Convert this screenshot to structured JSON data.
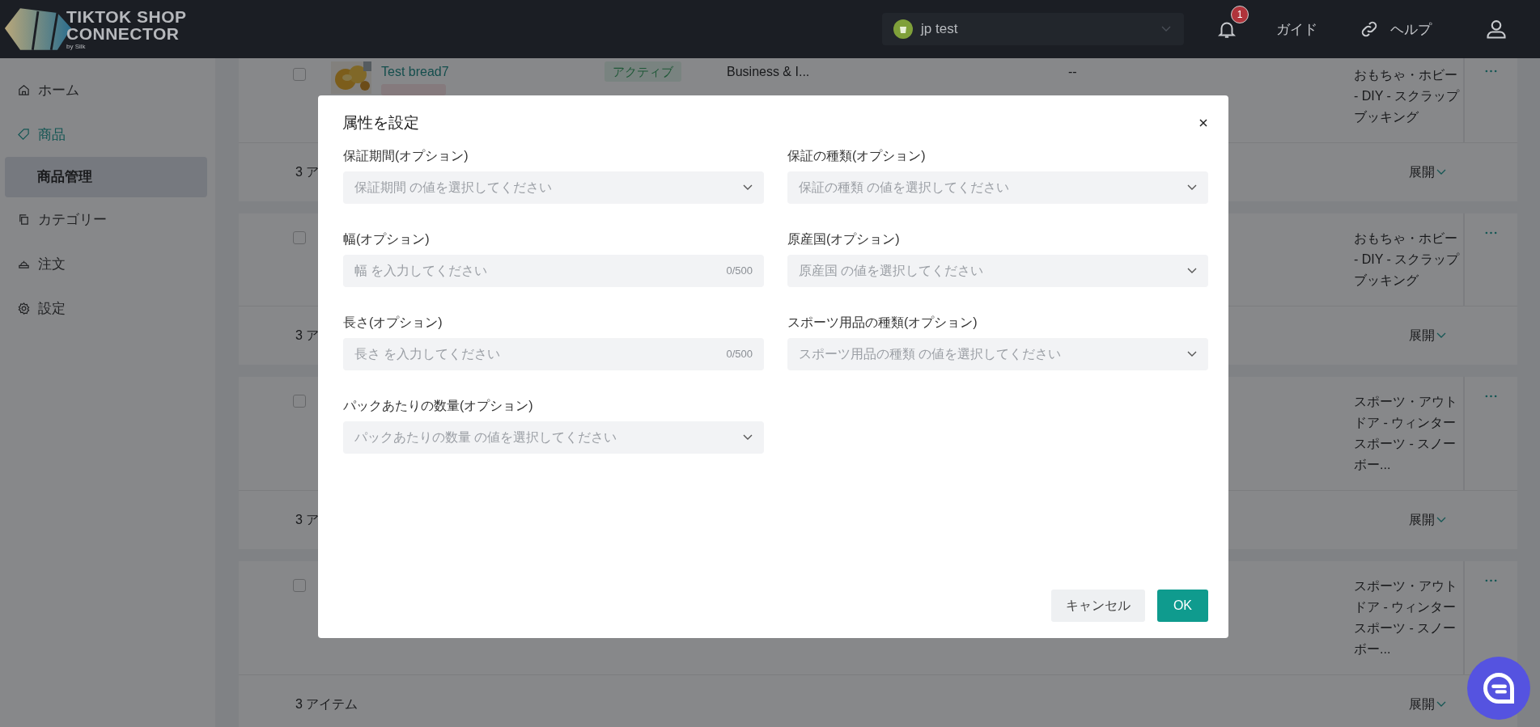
{
  "header": {
    "logo": {
      "line1": "TIKTOK SHOP",
      "line2": "CONNECTOR",
      "byline": "by Silk"
    },
    "store": {
      "value": "jp test"
    },
    "notifications": "1",
    "links": [
      {
        "label": "ガイド"
      },
      {
        "label": "ヘルプ"
      }
    ]
  },
  "sidebar": {
    "items": [
      {
        "label": "ホーム",
        "active": false
      },
      {
        "label": "商品",
        "active": true,
        "children": [
          {
            "label": "商品管理",
            "selected": true
          }
        ]
      },
      {
        "label": "カテゴリー",
        "active": false
      },
      {
        "label": "注文",
        "active": false
      },
      {
        "label": "設定",
        "active": false
      }
    ]
  },
  "groups": [
    {
      "product": {
        "checked": false,
        "name": "Test bread7",
        "status": "アクティブ",
        "category": "Business & I...",
        "column_5": "--",
        "category_path": [
          "おもちゃ・ホビー",
          "- DIY - スクラップ",
          "ブッキング"
        ]
      },
      "footer": {
        "count": "3 ア",
        "expand": "展開"
      }
    },
    {
      "product": {
        "checked": false,
        "category_path": [
          "おもちゃ・ホビー",
          "- DIY - スクラップ",
          "ブッキング"
        ]
      },
      "footer": {
        "count": "3 ア",
        "expand": "展開"
      }
    },
    {
      "product": {
        "checked": false,
        "category_path": [
          "スポーツ・アウト",
          "ドア - ウィンター",
          "スポーツ - スノー",
          "ボー..."
        ]
      },
      "footer": {
        "count": "3 ア",
        "expand": "展開"
      }
    },
    {
      "product": {
        "checked": false,
        "category_path": [
          "スポーツ・アウト",
          "ドア - ウィンター",
          "スポーツ - スノー",
          "ボー..."
        ]
      },
      "footer": {
        "count": "3 アイテム",
        "expand": "展開"
      }
    }
  ],
  "dialog": {
    "title": "属性を設定",
    "fields": [
      {
        "label": "保証期間(オプション)",
        "kind": "select",
        "placeholder": "保証期間 の値を選択してください"
      },
      {
        "label": "保証の種類(オプション)",
        "kind": "select",
        "placeholder": "保証の種類 の値を選択してください"
      },
      {
        "label": "幅(オプション)",
        "kind": "text",
        "placeholder": "幅 を入力してください",
        "counter": "0/500"
      },
      {
        "label": "原産国(オプション)",
        "kind": "select",
        "placeholder": "原産国 の値を選択してください"
      },
      {
        "label": "長さ(オプション)",
        "kind": "text",
        "placeholder": "長さ を入力してください",
        "counter": "0/500"
      },
      {
        "label": "スポーツ用品の種類(オプション)",
        "kind": "select",
        "placeholder": "スポーツ用品の種類 の値を選択してください"
      },
      {
        "label": "パックあたりの数量(オプション)",
        "kind": "select",
        "placeholder": "パックあたりの数量 の値を選択してください"
      }
    ],
    "buttons": [
      {
        "label": "キャンセル",
        "kind": "secondary"
      },
      {
        "label": "OK",
        "kind": "primary"
      }
    ]
  }
}
